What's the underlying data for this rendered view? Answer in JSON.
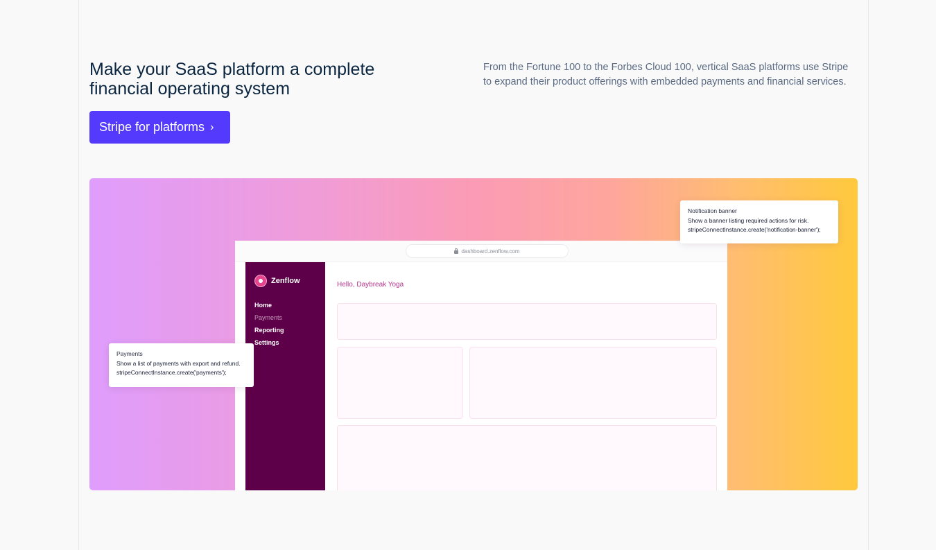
{
  "section": {
    "headline": "Make your SaaS platform a complete financial operating system",
    "description": "From the Fortune 100 to the Forbes Cloud 100, vertical SaaS platforms use Stripe to expand their product offerings with embedded payments and financial services.",
    "cta_label": "Stripe for platforms",
    "cta_icon": "chevron-right-icon"
  },
  "mock": {
    "url": "dashboard.zenflow.com",
    "brand": "Zenflow",
    "greeting": "Hello, Daybreak Yoga",
    "nav": [
      {
        "label": "Home",
        "active": true
      },
      {
        "label": "Payments",
        "active": false
      },
      {
        "label": "Reporting",
        "active": true
      },
      {
        "label": "Settings",
        "active": true
      }
    ]
  },
  "tooltips": {
    "notification": {
      "title": "Notification banner",
      "description": "Show a banner listing required actions for risk.",
      "code": "stripeConnectInstance.create('notification-banner');"
    },
    "payments": {
      "title": "Payments",
      "description": "Show a list of payments with export and refund.",
      "code": "stripeConnectInstance.create('payments');"
    }
  },
  "colors": {
    "cta": "#533afd",
    "headline": "#0a2540",
    "sidebar": "#5e0049",
    "greeting": "#b4358c"
  }
}
